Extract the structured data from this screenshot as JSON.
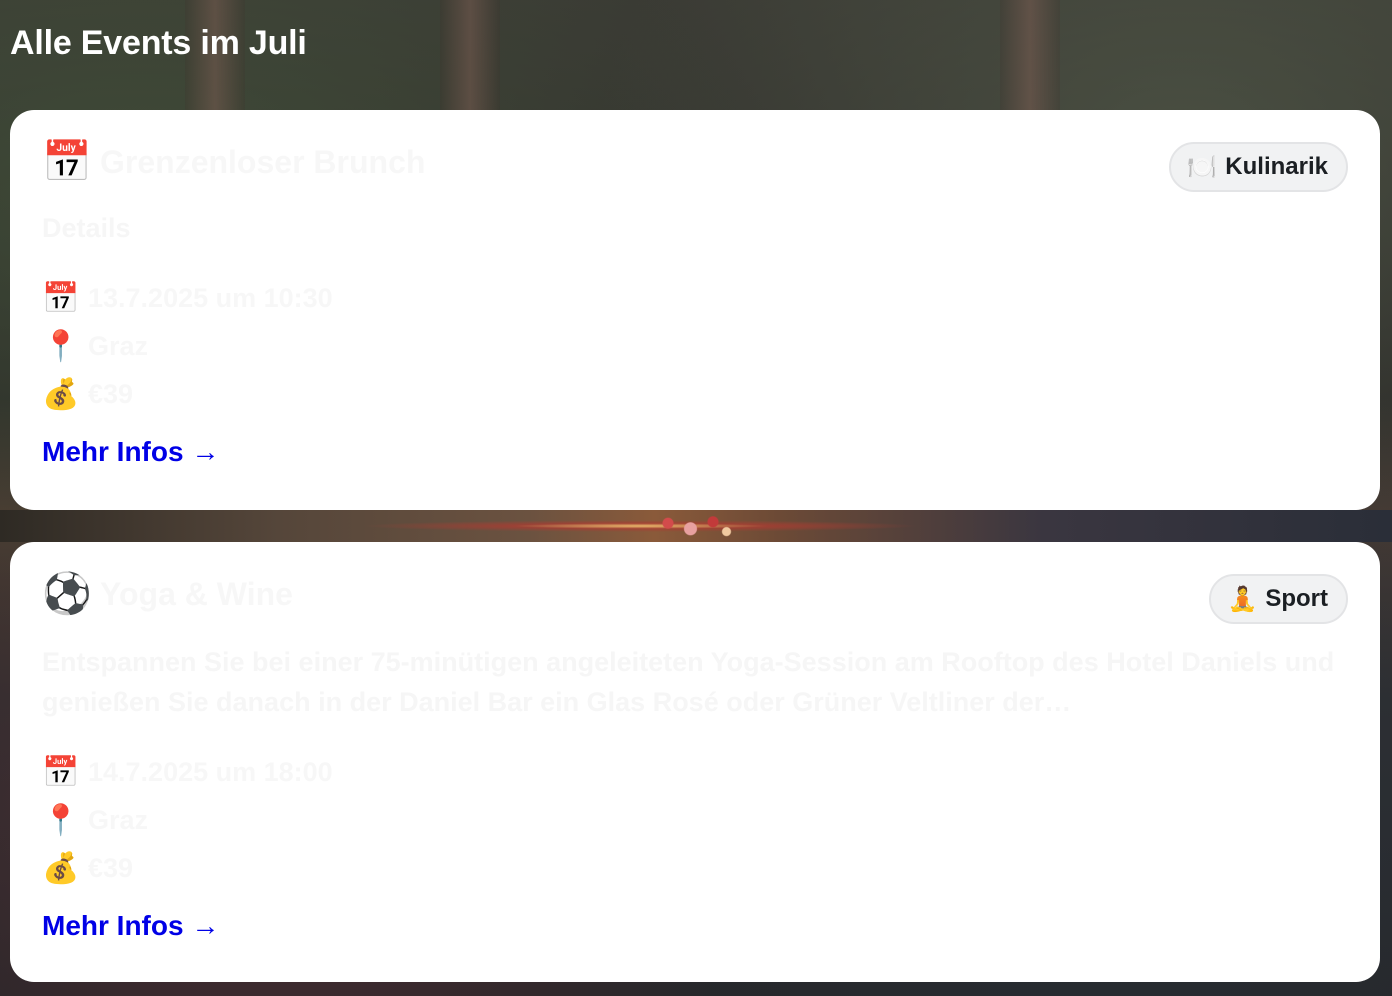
{
  "page": {
    "title": "Alle Events im Juli"
  },
  "events": [
    {
      "title_icon": "📅",
      "title": "Grenzenloser Brunch",
      "category_icon": "🍽️",
      "category": "Kulinarik",
      "description": "Details",
      "date_icon": "📅",
      "date": "13.7.2025 um 10:30",
      "location_icon": "📍",
      "location": "Graz",
      "price_icon": "💰",
      "price": "€39",
      "link_label": "Mehr Infos →"
    },
    {
      "title_icon": "⚽",
      "title": "Yoga & Wine",
      "category_icon": "🧘",
      "category": "Sport",
      "description": "Entspannen Sie bei einer 75-minütigen angeleiteten Yoga-Session am Rooftop des Hotel Daniels und genießen Sie danach in der Daniel Bar ein Glas Rosé oder Grüner Veltliner der…",
      "date_icon": "📅",
      "date": "14.7.2025 um 18:00",
      "location_icon": "📍",
      "location": "Graz",
      "price_icon": "💰",
      "price": "€39",
      "link_label": "Mehr Infos →"
    }
  ],
  "colors": {
    "link": "#0000e6",
    "card_background": "#ffffff",
    "badge_background": "#f1f2f3"
  }
}
